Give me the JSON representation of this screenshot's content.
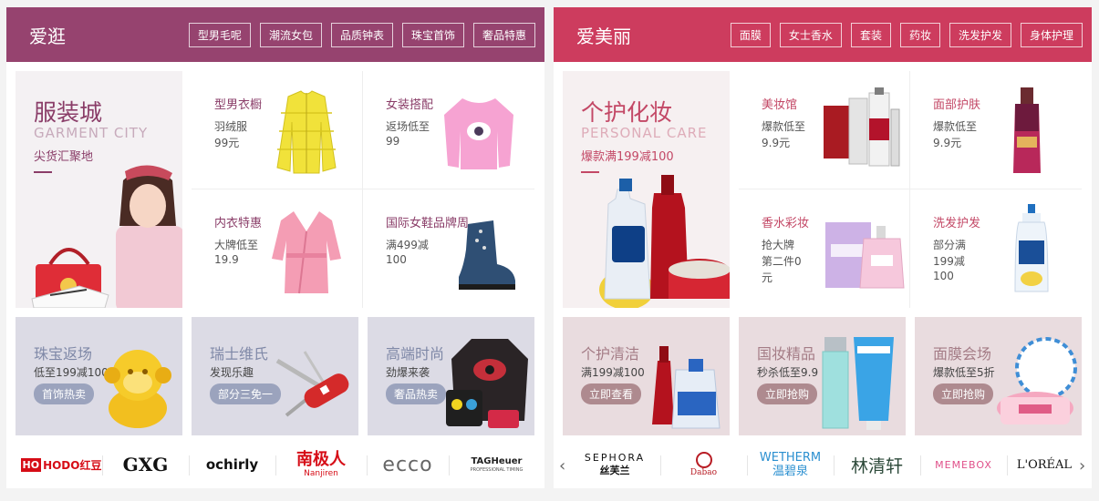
{
  "panel1": {
    "title": "爱逛",
    "tags": [
      "型男毛呢",
      "潮流女包",
      "品质钟表",
      "珠宝首饰",
      "奢品特惠"
    ],
    "hero": {
      "title": "服装城",
      "en": "GARMENT CITY",
      "sub": "尖货汇聚地"
    },
    "cells": [
      {
        "title": "型男衣橱",
        "lines": [
          "羽绒服",
          "99元"
        ],
        "icon": "yellow-down-jacket"
      },
      {
        "title": "女装搭配",
        "lines": [
          "返场低至",
          "99"
        ],
        "icon": "pink-sweater"
      },
      {
        "title": "内衣特惠",
        "lines": [
          "大牌低至",
          "19.9"
        ],
        "icon": "pink-bathrobe"
      },
      {
        "title": "国际女鞋品牌周",
        "lines": [
          "满499减",
          "100"
        ],
        "icon": "blue-ankle-boot"
      }
    ],
    "promos": [
      {
        "title": "珠宝返场",
        "sub": "低至199减100",
        "btn": "首饰热卖",
        "icon": "gold-monkey"
      },
      {
        "title": "瑞士维氏",
        "sub": "发现乐趣",
        "btn": "部分三免一",
        "icon": "swiss-army-knife"
      },
      {
        "title": "高端时尚",
        "sub": "劲爆来袭",
        "btn": "奢品热卖",
        "icon": "sweater-and-bag"
      }
    ],
    "brands": [
      "HODO红豆",
      "GXG",
      "ochirly",
      "南极人",
      "ecco",
      "TAGHeuer"
    ],
    "brand_sub": [
      "Nanjiren",
      "PROFESSIONAL TIMING"
    ]
  },
  "panel2": {
    "title": "爱美丽",
    "tags": [
      "面膜",
      "女士香水",
      "套装",
      "药妆",
      "洗发护发",
      "身体护理"
    ],
    "hero": {
      "title": "个护化妆",
      "en": "PERSONAL CARE",
      "sub": "爆款满199减100"
    },
    "cells": [
      {
        "title": "美妆馆",
        "lines": [
          "爆款低至",
          "9.9元"
        ],
        "icon": "skii-set"
      },
      {
        "title": "面部护肤",
        "lines": [
          "爆款低至",
          "9.9元"
        ],
        "icon": "serum-bottle"
      },
      {
        "title": "香水彩妆",
        "lines": [
          "抢大牌",
          "第二件0",
          "元"
        ],
        "icon": "chanel-perfume"
      },
      {
        "title": "洗发护发",
        "lines": [
          "部分满",
          "199减",
          "100"
        ],
        "icon": "shampoo-bottle"
      }
    ],
    "promos": [
      {
        "title": "个护清洁",
        "sub": "满199减100",
        "btn": "立即查看",
        "icon": "detergent-bottles"
      },
      {
        "title": "国妆精品",
        "sub": "秒杀低至9.9",
        "btn": "立即抢购",
        "icon": "skincare-tubes"
      },
      {
        "title": "面膜会场",
        "sub": "爆款低至5折",
        "btn": "立即抢购",
        "icon": "facial-masks"
      }
    ],
    "brands": [
      "SEPHORA",
      "Dabao",
      "WETHERM",
      "林清轩",
      "MEMEBOX",
      "L'ORÉAL"
    ],
    "brand_sub": [
      "丝芙兰",
      "温碧泉"
    ],
    "arrow_left": "‹",
    "arrow_right": "›"
  },
  "colors": {
    "panel1_header": "#96436f",
    "panel2_header": "#cd3c5e",
    "panel1_accent": "#8a3d68",
    "panel2_accent": "#c34866"
  }
}
